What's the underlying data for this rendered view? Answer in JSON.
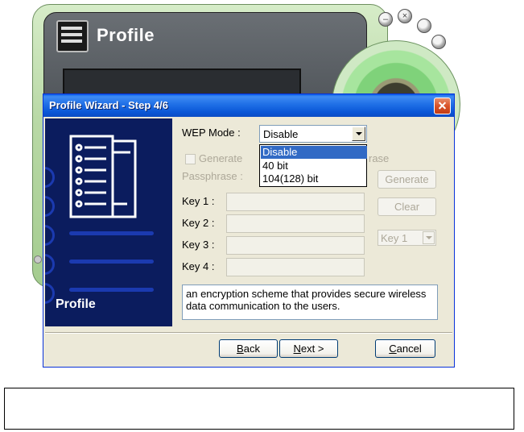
{
  "background_app": {
    "title": "Profile",
    "buttons": {
      "minimize_symbol": "–",
      "close_symbol": "×"
    }
  },
  "dialog": {
    "title": "Profile Wizard - Step 4/6",
    "side_label": "Profile",
    "wep_mode": {
      "label": "WEP Mode :",
      "selected": "Disable",
      "options": [
        "Disable",
        "40 bit",
        "104(128) bit"
      ]
    },
    "generate_checkbox": {
      "label_left": "Generate",
      "label_right": "rase"
    },
    "passphrase": {
      "label": "Passphrase :",
      "button_label": "Generate"
    },
    "keys": [
      {
        "label": "Key 1 :"
      },
      {
        "label": "Key 2 :"
      },
      {
        "label": "Key 3 :"
      },
      {
        "label": "Key 4 :"
      }
    ],
    "clear_button": "Clear",
    "key_select": {
      "selected": "Key 1"
    },
    "description": "an encryption scheme that provides secure wireless data communication to the users.",
    "footer": {
      "back": {
        "mnemonic": "B",
        "rest": "ack"
      },
      "next": {
        "mnemonic": "N",
        "rest": "ext >"
      },
      "cancel": {
        "mnemonic": "C",
        "rest": "ancel"
      }
    }
  },
  "colors": {
    "title_bar": "#0a56d6",
    "side_panel": "#0b1c5e",
    "selection": "#316ac5",
    "skin_green": "#a4cc8f"
  }
}
